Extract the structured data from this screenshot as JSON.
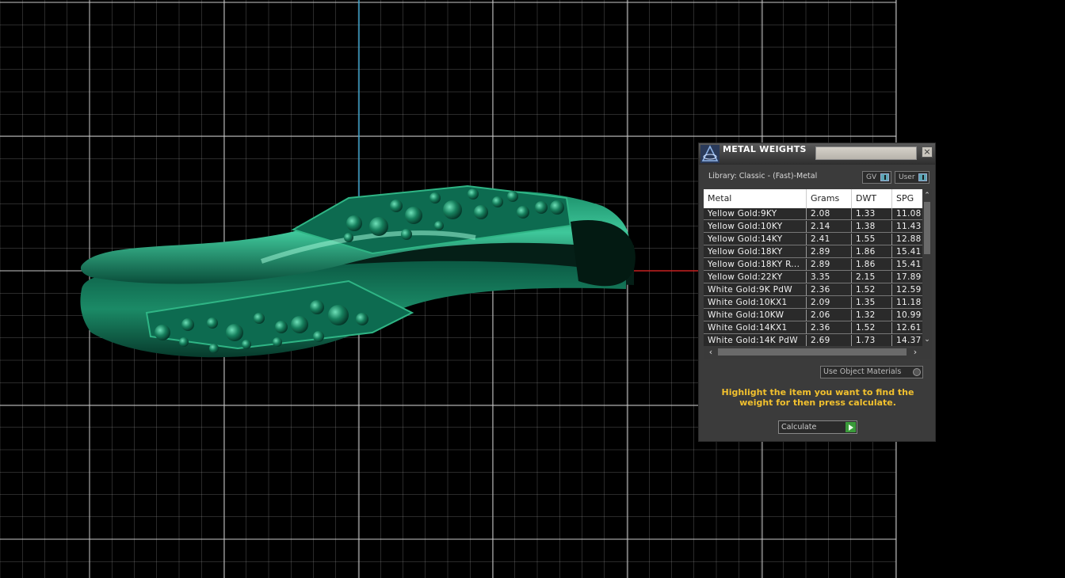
{
  "panel": {
    "title": "METAL WEIGHTS",
    "close_label": "×",
    "library": "Library: Classic - (Fast)-Metal",
    "toggles": {
      "gv": "GV",
      "user": "User"
    },
    "columns": [
      "Metal",
      "Grams",
      "DWT",
      "SPG"
    ],
    "rows": [
      [
        "Yellow Gold:9KY",
        "2.08",
        "1.33",
        "11.08"
      ],
      [
        "Yellow Gold:10KY",
        "2.14",
        "1.38",
        "11.43"
      ],
      [
        "Yellow Gold:14KY",
        "2.41",
        "1.55",
        "12.88"
      ],
      [
        "Yellow Gold:18KY",
        "2.89",
        "1.86",
        "15.41"
      ],
      [
        "Yellow Gold:18KY R...",
        "2.89",
        "1.86",
        "15.41"
      ],
      [
        "Yellow Gold:22KY",
        "3.35",
        "2.15",
        "17.89"
      ],
      [
        "White Gold:9K PdW",
        "2.36",
        "1.52",
        "12.59"
      ],
      [
        "White Gold:10KX1",
        "2.09",
        "1.35",
        "11.18"
      ],
      [
        "White Gold:10KW",
        "2.06",
        "1.32",
        "10.99"
      ],
      [
        "White Gold:14KX1",
        "2.36",
        "1.52",
        "12.61"
      ],
      [
        "White Gold:14K PdW",
        "2.69",
        "1.73",
        "14.37"
      ]
    ],
    "use_materials_label": "Use Object Materials",
    "instructions": "Highlight the item you want to find the weight for then press calculate.",
    "calculate_label": "Calculate"
  },
  "colors": {
    "viewport_background": "#000000",
    "grid": "#9a9a9a",
    "axis_vertical": "#3aa0c8",
    "axis_horizontal": "#c82020",
    "ring": "#0e7a5a",
    "instructions_text": "#f2c12e"
  },
  "icons": {
    "logo": "triangle-logo-icon",
    "close": "close-icon",
    "scroll_up": "chevron-up-icon",
    "scroll_down": "chevron-down-icon",
    "scroll_left": "chevron-left-icon",
    "scroll_right": "chevron-right-icon",
    "calculate": "play-arrow-icon"
  }
}
